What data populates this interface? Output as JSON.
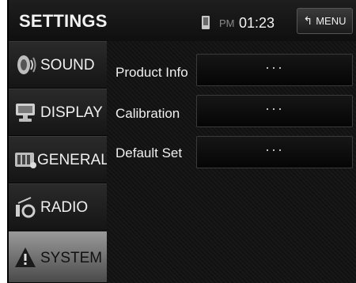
{
  "header": {
    "title": "SETTINGS",
    "clock_ampm": "PM",
    "clock_time": "01:23",
    "menu_label": "MENU",
    "phone_icon": "phone-icon"
  },
  "sidebar": {
    "items": [
      {
        "label": "SOUND",
        "icon": "speaker-icon",
        "active": false
      },
      {
        "label": "DISPLAY",
        "icon": "monitor-icon",
        "active": false
      },
      {
        "label": "GENERAL",
        "icon": "general-icon",
        "active": false
      },
      {
        "label": "RADIO",
        "icon": "radio-icon",
        "active": false
      },
      {
        "label": "SYSTEM",
        "icon": "warning-icon",
        "active": true
      }
    ]
  },
  "main": {
    "rows": [
      {
        "label": "Product Info",
        "value": "···"
      },
      {
        "label": "Calibration",
        "value": "···"
      },
      {
        "label": "Default Set",
        "value": "···"
      }
    ]
  },
  "colors": {
    "background": "#141414",
    "active_item": "#9a9a9a",
    "text": "#f0f0f0"
  }
}
